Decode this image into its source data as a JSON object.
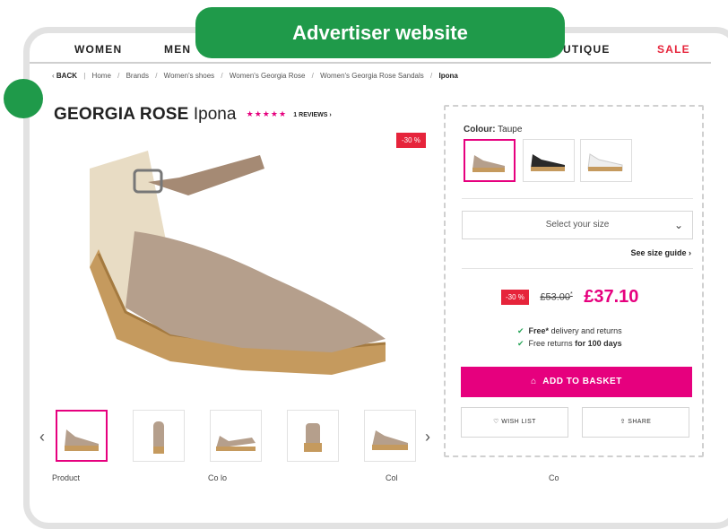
{
  "overlay": {
    "badge": "Advertiser website"
  },
  "nav": {
    "women": "WOMEN",
    "men": "MEN",
    "boutique": "UTIQUE",
    "sale": "SALE"
  },
  "breadcrumb": {
    "back": "BACK",
    "items": [
      "Home",
      "Brands",
      "Women's shoes",
      "Women's Georgia Rose",
      "Women's Georgia Rose Sandals"
    ],
    "current": "Ipona"
  },
  "product": {
    "brand": "GEORGIA ROSE",
    "name": "Ipona",
    "stars": "★★★★★",
    "reviews": "1 REVIEWS ›",
    "discount_tag": "-30 %"
  },
  "panel": {
    "colour_label": "Colour:",
    "colour_value": "Taupe",
    "size_placeholder": "Select your size",
    "size_guide": "See size guide ›",
    "discount": "-30 %",
    "old_price": "£53.00",
    "old_price_mark": "*",
    "new_price": "£37.10",
    "delivery_bold": "Free*",
    "delivery_text": "delivery and returns",
    "returns_text": "Free returns",
    "returns_bold": "for 100 days",
    "basket_label": "ADD TO BASKET",
    "wishlist_label": "WISH LIST",
    "share_label": "SHARE"
  },
  "footer_labels": [
    "Product",
    "Co lo",
    "Col",
    "Co"
  ],
  "colors": {
    "accent": "#e6007e",
    "sale": "#e6243b",
    "badge": "#1f9a4a"
  }
}
